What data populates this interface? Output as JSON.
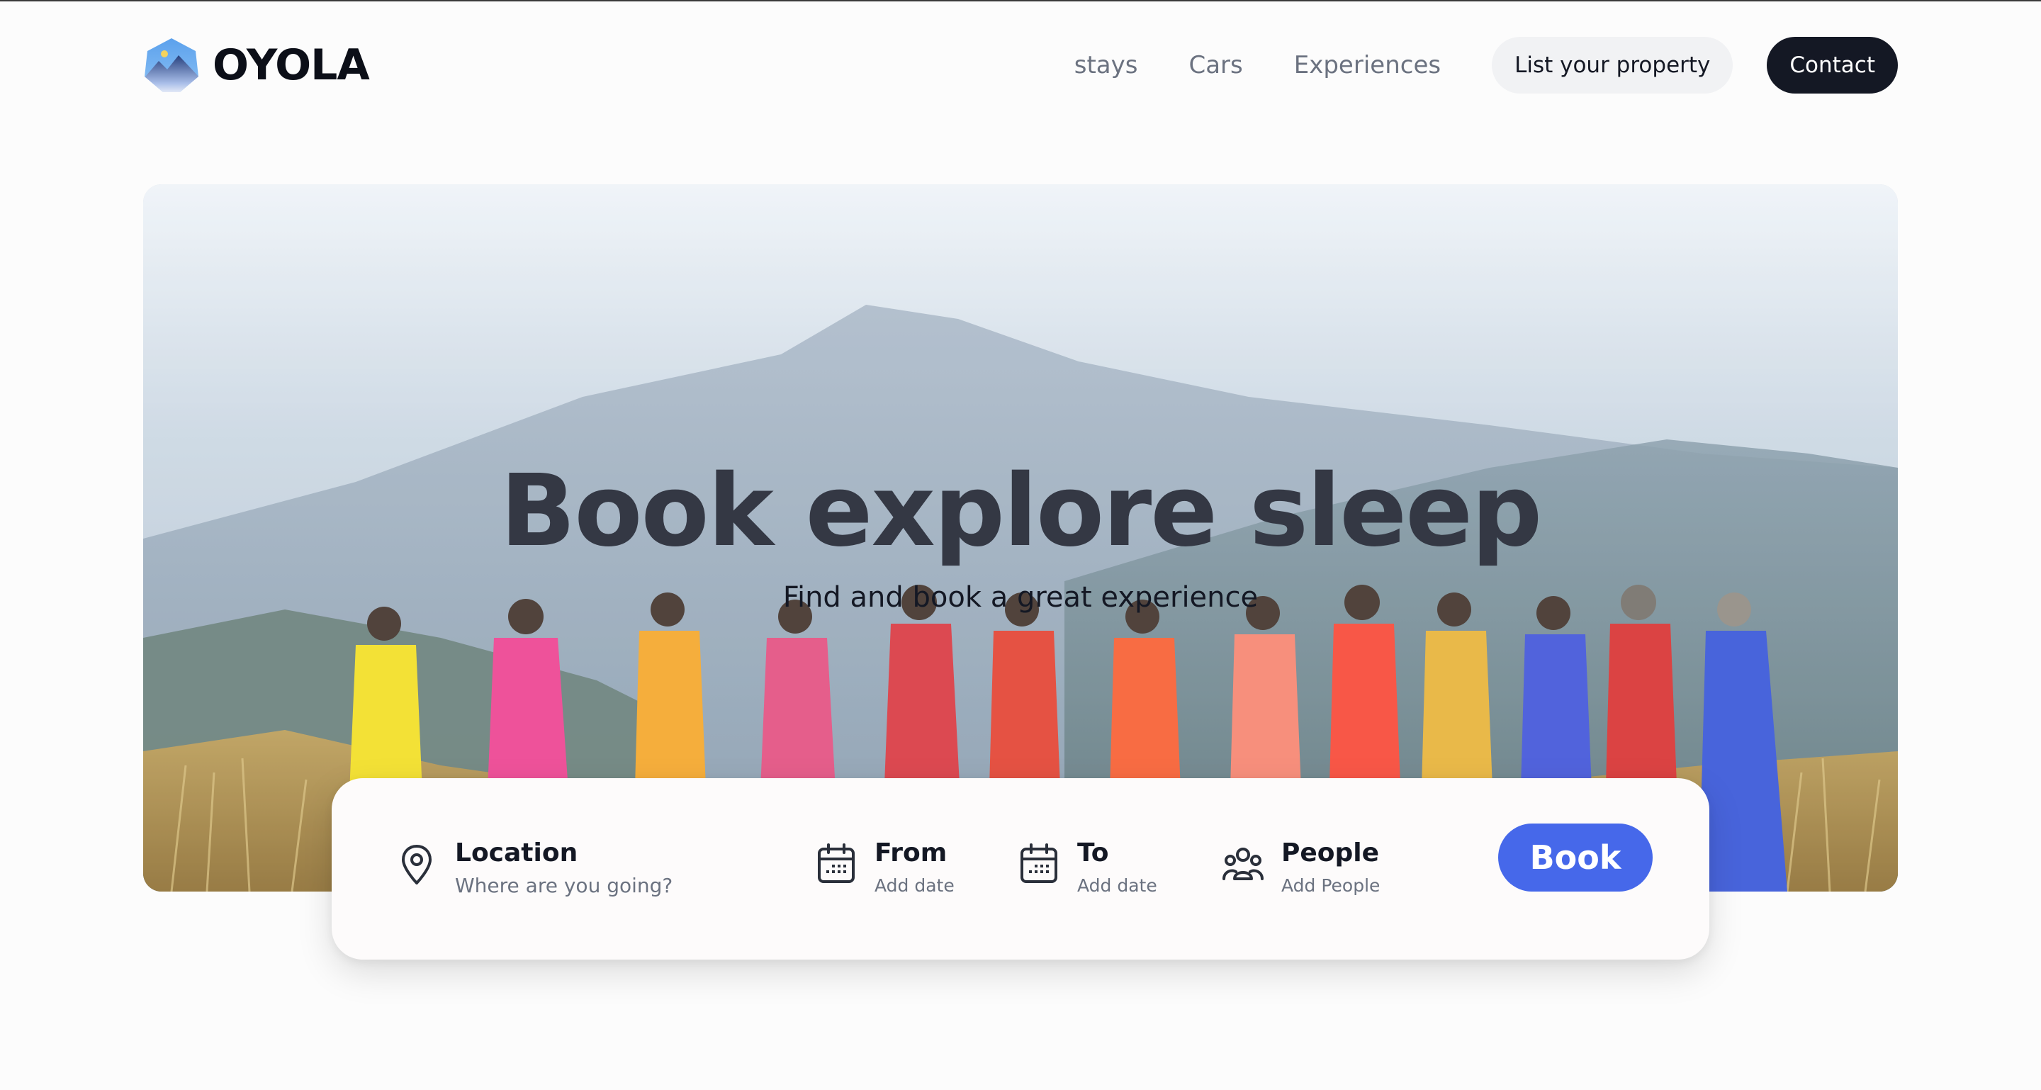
{
  "brand": {
    "name": "OYOLA",
    "logo_icon": "mountain-hexagon-icon"
  },
  "nav": {
    "links": [
      "stays",
      "Cars",
      "Experiences"
    ],
    "list_property": "List your property",
    "contact": "Contact"
  },
  "hero": {
    "title": "Book explore sleep",
    "subtitle": "Find and book a great experience"
  },
  "search": {
    "location": {
      "label": "Location",
      "placeholder": "Where are you going?",
      "icon": "map-pin-icon"
    },
    "from": {
      "label": "From",
      "placeholder": "Add date",
      "icon": "calendar-icon"
    },
    "to": {
      "label": "To",
      "placeholder": "Add date",
      "icon": "calendar-icon"
    },
    "people": {
      "label": "People",
      "placeholder": "Add People",
      "icon": "people-group-icon"
    },
    "book_button": "Book"
  },
  "colors": {
    "primary_dark": "#141824",
    "accent_blue": "#4668ea",
    "muted_text": "#6b7280",
    "pill_bg": "#f1f2f4",
    "page_bg": "#fcfcfc"
  }
}
